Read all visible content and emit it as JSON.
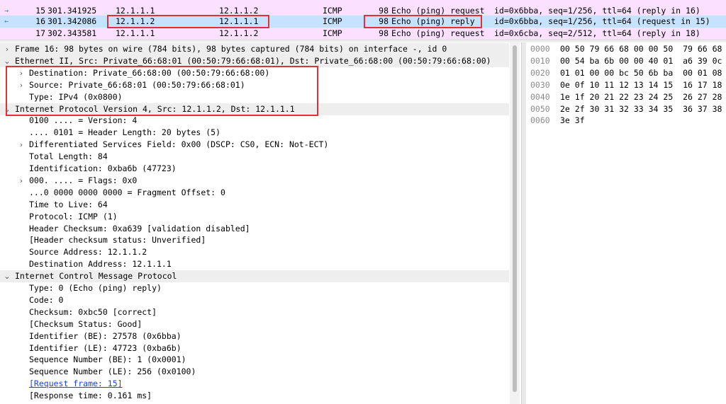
{
  "packet_list": {
    "rows": [
      {
        "no": "15",
        "time": "301.341925",
        "source": "12.1.1.1",
        "destination": "12.1.1.2",
        "protocol": "ICMP",
        "length": "98",
        "info": "Echo (ping) request",
        "info_rest": "id=0x6bba, seq=1/256, ttl=64 (reply in 16)"
      },
      {
        "no": "16",
        "time": "301.342086",
        "source": "12.1.1.2",
        "destination": "12.1.1.1",
        "protocol": "ICMP",
        "length": "98",
        "info": "Echo (ping) reply",
        "info_rest": "id=0x6bba, seq=1/256, ttl=64 (request in 15)"
      },
      {
        "no": "17",
        "time": "302.343581",
        "source": "12.1.1.1",
        "destination": "12.1.1.2",
        "protocol": "ICMP",
        "length": "98",
        "info": "Echo (ping) request",
        "info_rest": "id=0x6cba, seq=2/512, ttl=64 (reply in 18)"
      }
    ]
  },
  "details": {
    "lines": [
      {
        "indent": 0,
        "chevron": "›",
        "text": "Frame 16: 98 bytes on wire (784 bits), 98 bytes captured (784 bits) on interface -, id 0"
      },
      {
        "indent": 0,
        "chevron": "⌄",
        "text": "Ethernet II, Src: Private_66:68:01 (00:50:79:66:68:01), Dst: Private_66:68:00 (00:50:79:66:68:00)"
      },
      {
        "indent": 1,
        "chevron": "›",
        "text": "Destination: Private_66:68:00 (00:50:79:66:68:00)"
      },
      {
        "indent": 1,
        "chevron": "›",
        "text": "Source: Private_66:68:01 (00:50:79:66:68:01)"
      },
      {
        "indent": 1,
        "chevron": "",
        "text": "Type: IPv4 (0x0800)"
      },
      {
        "indent": 0,
        "chevron": "⌄",
        "text": "Internet Protocol Version 4, Src: 12.1.1.2, Dst: 12.1.1.1"
      },
      {
        "indent": 1,
        "chevron": "",
        "text": "0100 .... = Version: 4"
      },
      {
        "indent": 1,
        "chevron": "",
        "text": ".... 0101 = Header Length: 20 bytes (5)"
      },
      {
        "indent": 1,
        "chevron": "›",
        "text": "Differentiated Services Field: 0x00 (DSCP: CS0, ECN: Not-ECT)"
      },
      {
        "indent": 1,
        "chevron": "",
        "text": "Total Length: 84"
      },
      {
        "indent": 1,
        "chevron": "",
        "text": "Identification: 0xba6b (47723)"
      },
      {
        "indent": 1,
        "chevron": "›",
        "text": "000. .... = Flags: 0x0"
      },
      {
        "indent": 1,
        "chevron": "",
        "text": "...0 0000 0000 0000 = Fragment Offset: 0"
      },
      {
        "indent": 1,
        "chevron": "",
        "text": "Time to Live: 64"
      },
      {
        "indent": 1,
        "chevron": "",
        "text": "Protocol: ICMP (1)"
      },
      {
        "indent": 1,
        "chevron": "",
        "text": "Header Checksum: 0xa639 [validation disabled]"
      },
      {
        "indent": 1,
        "chevron": "",
        "text": "[Header checksum status: Unverified]"
      },
      {
        "indent": 1,
        "chevron": "",
        "text": "Source Address: 12.1.1.2"
      },
      {
        "indent": 1,
        "chevron": "",
        "text": "Destination Address: 12.1.1.1"
      },
      {
        "indent": 0,
        "chevron": "⌄",
        "text": "Internet Control Message Protocol"
      },
      {
        "indent": 1,
        "chevron": "",
        "text": "Type: 0 (Echo (ping) reply)"
      },
      {
        "indent": 1,
        "chevron": "",
        "text": "Code: 0"
      },
      {
        "indent": 1,
        "chevron": "",
        "text": "Checksum: 0xbc50 [correct]"
      },
      {
        "indent": 1,
        "chevron": "",
        "text": "[Checksum Status: Good]"
      },
      {
        "indent": 1,
        "chevron": "",
        "text": "Identifier (BE): 27578 (0x6bba)"
      },
      {
        "indent": 1,
        "chevron": "",
        "text": "Identifier (LE): 47723 (0xba6b)"
      },
      {
        "indent": 1,
        "chevron": "",
        "text": "Sequence Number (BE): 1 (0x0001)"
      },
      {
        "indent": 1,
        "chevron": "",
        "text": "Sequence Number (LE): 256 (0x0100)"
      },
      {
        "indent": 1,
        "chevron": "",
        "text": "[Request frame: 15]",
        "link": true
      },
      {
        "indent": 1,
        "chevron": "",
        "text": "[Response time: 0.161 ms]"
      }
    ]
  },
  "bytes": {
    "rows": [
      {
        "offset": "0000",
        "hex": "00 50 79 66 68 00 00 50  79 66 68"
      },
      {
        "offset": "0010",
        "hex": "00 54 ba 6b 00 00 40 01  a6 39 0c"
      },
      {
        "offset": "0020",
        "hex": "01 01 00 00 bc 50 6b ba  00 01 08"
      },
      {
        "offset": "0030",
        "hex": "0e 0f 10 11 12 13 14 15  16 17 18"
      },
      {
        "offset": "0040",
        "hex": "1e 1f 20 21 22 23 24 25  26 27 28"
      },
      {
        "offset": "0050",
        "hex": "2e 2f 30 31 32 33 34 35  36 37 38"
      },
      {
        "offset": "0060",
        "hex": "3e 3f"
      }
    ]
  },
  "colors": {
    "request_row": "#fce0ff",
    "selected_row": "#c6e2ff",
    "annotation": "#e0303a",
    "link": "#1a45d6"
  }
}
